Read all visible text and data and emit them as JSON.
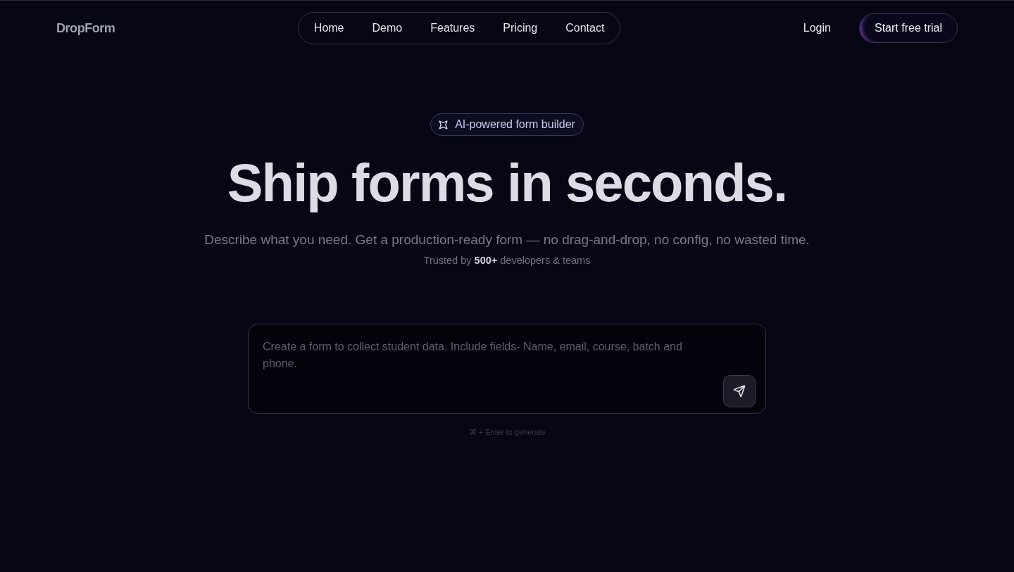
{
  "brand": {
    "name": "DropForm"
  },
  "nav": {
    "links": [
      "Home",
      "Demo",
      "Features",
      "Pricing",
      "Contact"
    ]
  },
  "actions": {
    "login": "Login",
    "cta": "Start free trial"
  },
  "hero": {
    "badge": "AI-powered form builder",
    "title": "Ship forms in seconds.",
    "subtitle": "Describe what you need. Get a production-ready form — no drag-and-drop, no config, no wasted time.",
    "trust": "Trusted by **500+** developers & teams"
  },
  "prompt": {
    "placeholder": "Create a form to collect student data. Include fields- Name, email, course, batch and phone.",
    "hint": "⌘ + Enter to generate"
  }
}
